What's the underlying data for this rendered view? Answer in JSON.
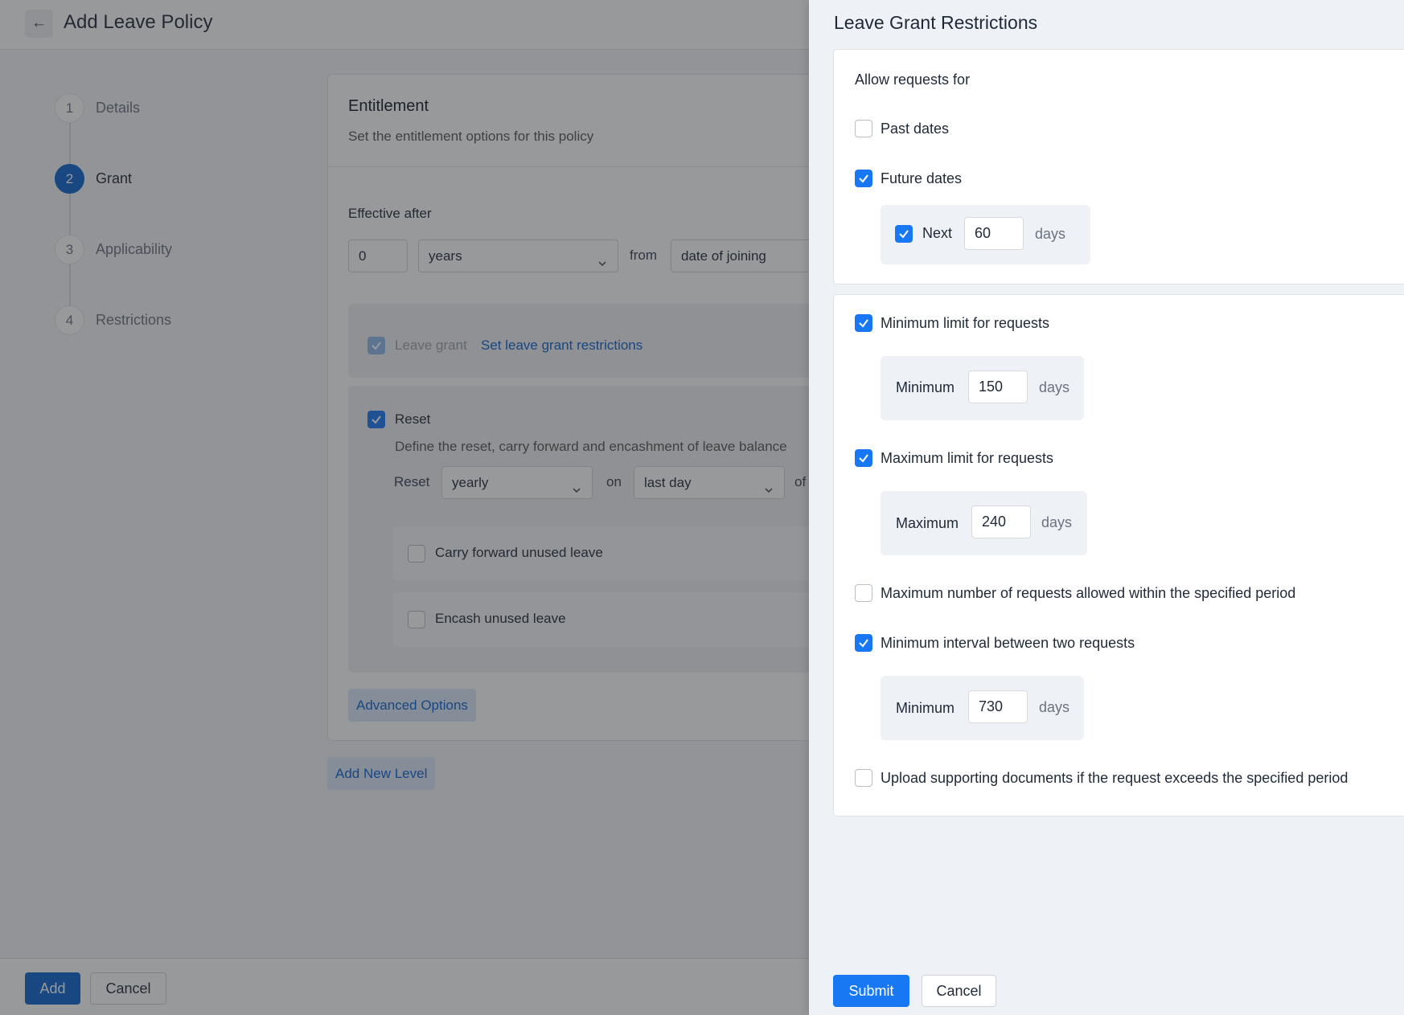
{
  "page": {
    "title": "Add Leave Policy",
    "steps": [
      {
        "num": "1",
        "label": "Details"
      },
      {
        "num": "2",
        "label": "Grant"
      },
      {
        "num": "3",
        "label": "Applicability"
      },
      {
        "num": "4",
        "label": "Restrictions"
      }
    ],
    "active_step": "Grant",
    "entitlement": {
      "title": "Entitlement",
      "subtitle": "Set the entitlement options for this policy",
      "effective_after_label": "Effective after",
      "effective_value": "0",
      "effective_unit": "years",
      "from_label": "from",
      "from_value": "date of joining",
      "leave_grant_label": "Leave grant",
      "leave_grant_link": "Set leave grant restrictions",
      "reset_label": "Reset",
      "reset_description": "Define the reset, carry forward and encashment of leave balance",
      "reset_row_label": "Reset",
      "reset_frequency": "yearly",
      "on_label": "on",
      "reset_day": "last day",
      "of_label": "of",
      "carry_forward_label": "Carry forward unused leave",
      "encash_label": "Encash unused leave",
      "advanced_options": "Advanced Options"
    },
    "add_new_level": "Add New Level",
    "footer": {
      "add": "Add",
      "cancel": "Cancel"
    }
  },
  "drawer": {
    "title": "Leave Grant Restrictions",
    "allow_requests_for": "Allow requests for",
    "past_dates": "Past dates",
    "future_dates": "Future dates",
    "next_label": "Next",
    "next_value": "60",
    "days": "days",
    "min_limit_label": "Minimum limit for requests",
    "minimum_label": "Minimum",
    "min_limit_value": "150",
    "max_limit_label": "Maximum limit for requests",
    "maximum_label": "Maximum",
    "max_limit_value": "240",
    "max_requests_label": "Maximum number of requests allowed within the specified period",
    "min_interval_label": "Minimum interval between two requests",
    "min_interval_value": "730",
    "upload_docs_label": "Upload supporting documents if the request exceeds the specified period",
    "submit": "Submit",
    "cancel": "Cancel",
    "checkbox_state": {
      "past_dates": false,
      "future_dates": true,
      "next": true,
      "min_limit": true,
      "max_limit": true,
      "max_requests": false,
      "min_interval": true,
      "upload_docs": false
    }
  },
  "colors": {
    "primary": "#0b63ce",
    "checkbox_checked": "#1877f2",
    "overlay": "rgba(40,42,46,0.48)"
  }
}
